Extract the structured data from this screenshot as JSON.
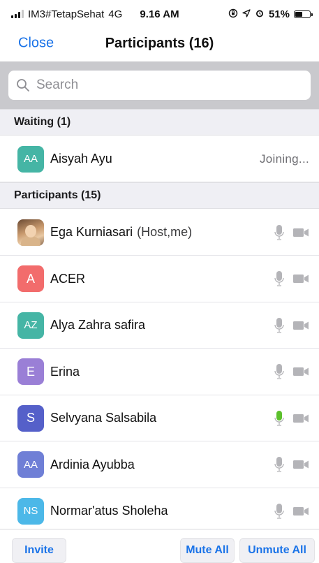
{
  "status_bar": {
    "carrier": "IM3#TetapSehat",
    "network": "4G",
    "time": "9.16 AM",
    "battery": "51%",
    "battery_level": 51
  },
  "nav": {
    "close_label": "Close",
    "title": "Participants (16)"
  },
  "search": {
    "placeholder": "Search"
  },
  "waiting": {
    "header": "Waiting (1)",
    "items": [
      {
        "initials": "AA",
        "name": "Aisyah Ayu",
        "status": "Joining...",
        "color": "#45b5a5"
      }
    ]
  },
  "participants": {
    "header": "Participants (15)",
    "items": [
      {
        "initials": "",
        "name": "Ega Kurniasari",
        "role": "(Host,me)",
        "color": "#b08a66",
        "mic_active": false
      },
      {
        "initials": "A",
        "name": "ACER",
        "role": "",
        "color": "#f26c6c",
        "mic_active": false
      },
      {
        "initials": "AZ",
        "name": "Alya Zahra safira",
        "role": "",
        "color": "#45b5a5",
        "mic_active": false
      },
      {
        "initials": "E",
        "name": "Erina",
        "role": "",
        "color": "#9a7fd6",
        "mic_active": false
      },
      {
        "initials": "S",
        "name": "Selvyana Salsabila",
        "role": "",
        "color": "#5560c9",
        "mic_active": true
      },
      {
        "initials": "AA",
        "name": "Ardinia Ayubba",
        "role": "",
        "color": "#6f7fd6",
        "mic_active": false
      },
      {
        "initials": "NS",
        "name": "Normar'atus Sholeha",
        "role": "",
        "color": "#4cb8e8",
        "mic_active": false
      }
    ]
  },
  "actions": {
    "invite": "Invite",
    "mute_all": "Mute All",
    "unmute_all": "Unmute All"
  },
  "colors": {
    "accent": "#1a73e8",
    "mic_active": "#5cc02c",
    "mic_idle": "#b4b4b8"
  }
}
